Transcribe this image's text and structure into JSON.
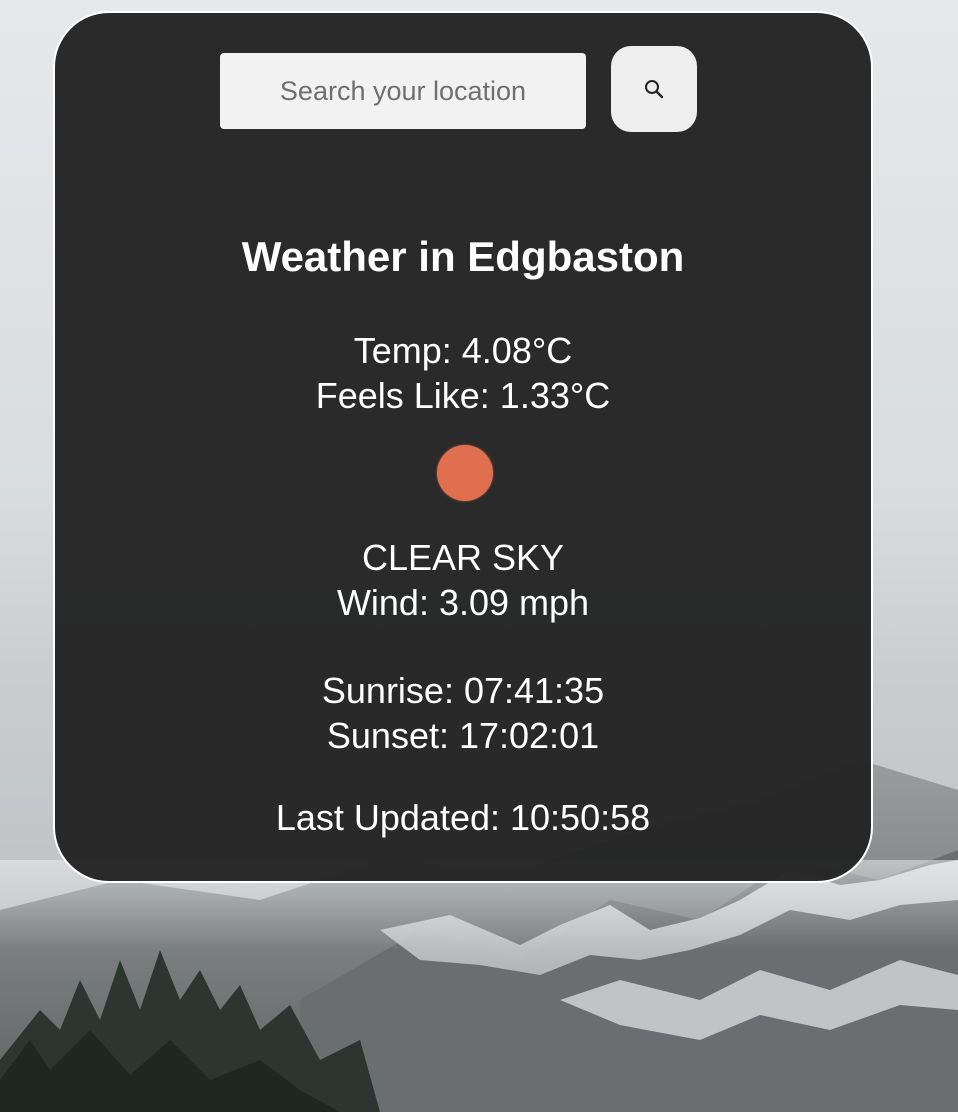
{
  "search": {
    "placeholder": "Search your location",
    "value": "",
    "button_icon": "search-icon"
  },
  "weather": {
    "title": "Weather in Edgbaston",
    "temp": "Temp: 4.08°C",
    "feels_like": "Feels Like: 1.33°C",
    "icon": "sun-icon",
    "icon_color": "#df6f4f",
    "description": "CLEAR SKY",
    "wind": "Wind: 3.09 mph",
    "sunrise": "Sunrise: 07:41:35",
    "sunset": "Sunset: 17:02:01",
    "last_updated": "Last Updated: 10:50:58"
  },
  "colors": {
    "card_background": "#222222",
    "card_border": "#ffffff",
    "text": "#ffffff",
    "input_background": "#f2f2f2"
  }
}
